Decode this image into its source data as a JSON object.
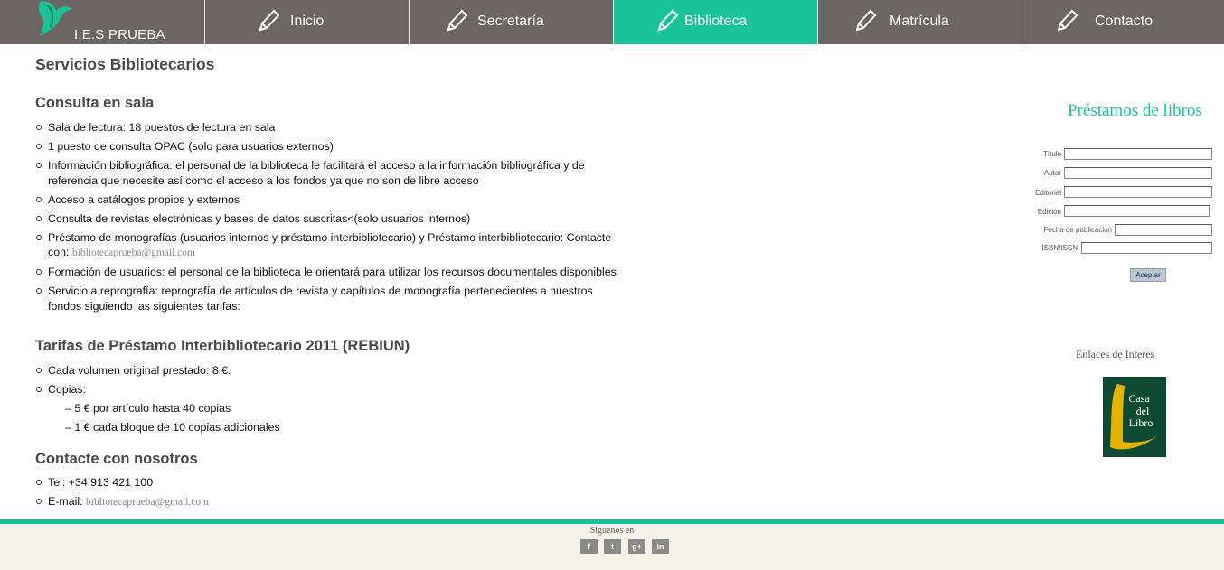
{
  "header": {
    "site_name": "I.E.S PRUEBA",
    "nav": [
      {
        "label": "Inicio"
      },
      {
        "label": "Secretaría"
      },
      {
        "label": "Biblioteca",
        "active": true
      },
      {
        "label": "Matrícula"
      },
      {
        "label": "Contacto"
      }
    ]
  },
  "main": {
    "page_title": "Servicios Bibliotecarios",
    "consulta": {
      "title": "Consulta en sala",
      "items": [
        "Sala de lectura: 18 puestos de lectura en sala",
        "1 puesto de consulta OPAC (solo para usuarios externos)",
        "Información bibliográfica: el personal de la biblioteca le facilitará el acceso a la información bibliográfica y de referencia que necesite así como el acceso a los fondos ya que no son de libre acceso",
        "Acceso a catálogos propios y externos",
        "Consulta de revistas electrónicas y bases de datos suscritas<(solo usuarios internos)",
        "Préstamo de monografías (usuarios internos y préstamo interbibliotecario) y Préstamo interbibliotecario: Contacte con:",
        "Formación de usuarios: el personal de la biblioteca le orientará para utilizar los recursos documentales disponibles",
        "Servicio a reprografía: reprografía de artículos de revista y capítulos de monografía pertenecientes a nuestros fondos siguiendo las siguientes tarifas:"
      ],
      "contact_email": "bibliotecaprueba@gmail.com"
    },
    "tarifas": {
      "title": "Tarifas de Préstamo Interbibliotecario 2011 (REBIUN)",
      "items": [
        "Cada volumen original prestado: 8 €.",
        "Copias:"
      ],
      "sub_items": [
        "– 5 € por artículo hasta 40 copias",
        "– 1 € cada bloque de 10 copias adicionales"
      ]
    },
    "contacte": {
      "title": "Contacte con nosotros",
      "tel": "Tel: +34 913 421 100",
      "email_label": "E-mail:",
      "email": "bibliotecaprueba@gmail.com"
    }
  },
  "sidebar": {
    "form_title": "Préstamos de libros",
    "fields": [
      {
        "label": "Título",
        "value": ""
      },
      {
        "label": "Autor",
        "value": ""
      },
      {
        "label": "Editorial",
        "value": ""
      },
      {
        "label": "Edición",
        "value": ""
      },
      {
        "label": "Fecha de publicación",
        "value": ""
      },
      {
        "label": "ISBN/ISSN",
        "value": ""
      }
    ],
    "submit_label": "Aceptar",
    "links_title": "Enlaces de Interes",
    "casa_logo": {
      "line1": "Casa",
      "line2": "del",
      "line3": "Libro"
    }
  },
  "footer": {
    "follow_text": "Siguenos en",
    "social": [
      {
        "icon": "facebook-icon",
        "glyph": "f"
      },
      {
        "icon": "twitter-icon",
        "glyph": "t"
      },
      {
        "icon": "google-plus-icon",
        "glyph": "g+"
      },
      {
        "icon": "linkedin-icon",
        "glyph": "in"
      }
    ]
  },
  "colors": {
    "nav_bg": "#6b6664",
    "accent": "#18c497",
    "footer_bg": "#f3f1ea"
  }
}
